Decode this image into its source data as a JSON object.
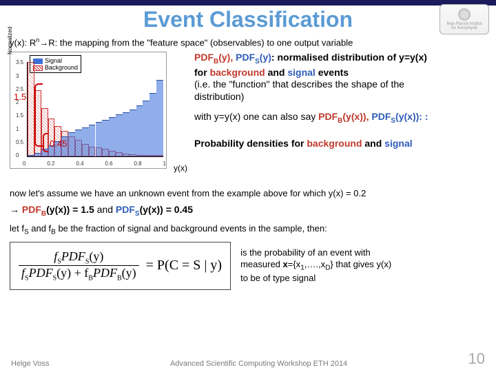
{
  "header": {
    "title": "Event Classification"
  },
  "logo": {
    "line1": "Max-Planck-Institut",
    "line2": "für Kernphysik"
  },
  "line1": {
    "lhs": "y(x): R",
    "sup": "n",
    "arrow": "→",
    "rhs": "R:  the mapping from the \"feature space\" (observables) to one output variable"
  },
  "chart": {
    "ylabel": "Normalized",
    "legend_signal": "Signal",
    "legend_background": "Background",
    "anno_bkg": "1.5",
    "anno_sig": "0.45",
    "yx_label": "y(x)",
    "xticks": [
      "0",
      "0.2",
      "0.4",
      "0.6",
      "0.8",
      "1"
    ],
    "yticks": [
      "0",
      "0.5",
      "1",
      "1.5",
      "2",
      "2.5",
      "3",
      "3.5"
    ]
  },
  "pdf_block": {
    "t1a": "PDF",
    "t1b": "B",
    "t1c": "(y), ",
    "t2a": "PDF",
    "t2b": "S",
    "t2c": "(y)",
    "t3": ":  normalised distribution of y=y(x)",
    "t4a": "   for ",
    "t4b": "background",
    "t4c": " and ",
    "t4d": "signal",
    "t4e": " events",
    "t5": "(i.e. the \"function\" that describes the shape of the",
    "t6": "   distribution)",
    "t7a": "with y=y(x) one can also say ",
    "t7b": "PDF",
    "t7c": "B",
    "t7d": "(y(x)), ",
    "t7e": "PDF",
    "t7f": "S",
    "t7g": "(y(x)): :",
    "t8a": "Probability densities for ",
    "t8b": "background",
    "t8c": " and ",
    "t8d": "signal"
  },
  "body": {
    "p1": "now let's assume we have an unknown event from the example above for which  y(x) = 0.2",
    "p2_arrow": "→ ",
    "p2a": "PDF",
    "p2b": "B",
    "p2c": "(y(x)) = 1.5",
    "p2d": "  and ",
    "p2e": "PDF",
    "p2f": "S",
    "p2g": "(y(x)) = 0.45",
    "p3a": "let f",
    "p3b": "S",
    "p3c": " and f",
    "p3d": "B",
    "p3e": " be the fraction of signal and background events in the sample, then:"
  },
  "equation": {
    "num": "f",
    "num_sub": "S",
    "num2": "PDF",
    "num2_sub": "S",
    "num3": "(y)",
    "den1": "f",
    "den1_sub": "S",
    "den2": "PDF",
    "den2_sub": "S",
    "den3": "(y) + f",
    "den3_sub": "B",
    "den4": "PDF",
    "den4_sub": "B",
    "den5": "(y)",
    "rhs": "= P(C = S | y)"
  },
  "eqright": {
    "l1": "is the probability of an event with",
    "l2a": "measured ",
    "l2b": "x",
    "l2c": "={x",
    "l2d": "1",
    "l2e": ",….,x",
    "l2f": "D",
    "l2g": "} that gives y(x)",
    "l3": "to be of type signal"
  },
  "footer": {
    "author": "Helge Voss",
    "venue": "Advanced Scientific Computing Workshop ETH 2014",
    "page": "10"
  },
  "chart_data": {
    "type": "bar",
    "title": "",
    "xlabel": "y(x)",
    "ylabel": "Normalized",
    "xlim": [
      0,
      1
    ],
    "ylim": [
      0,
      3.7
    ],
    "bin_edges": [
      0.0,
      0.05,
      0.1,
      0.15,
      0.2,
      0.25,
      0.3,
      0.35,
      0.4,
      0.45,
      0.5,
      0.55,
      0.6,
      0.65,
      0.7,
      0.75,
      0.8,
      0.85,
      0.9,
      0.95,
      1.0
    ],
    "series": [
      {
        "name": "Background",
        "values": [
          3.7,
          2.6,
          1.9,
          1.5,
          1.2,
          1.0,
          0.8,
          0.65,
          0.5,
          0.4,
          0.35,
          0.3,
          0.22,
          0.18,
          0.12,
          0.08,
          0.05,
          0.03,
          0.02,
          0.01
        ]
      },
      {
        "name": "Signal",
        "values": [
          0.05,
          0.15,
          0.3,
          0.45,
          0.6,
          0.8,
          0.95,
          1.05,
          1.15,
          1.25,
          1.35,
          1.45,
          1.55,
          1.65,
          1.75,
          1.85,
          2.0,
          2.2,
          2.5,
          3.0
        ]
      }
    ],
    "annotations": [
      {
        "label": "1.5",
        "series": "Background",
        "x": 0.2,
        "y": 1.5
      },
      {
        "label": "0.45",
        "series": "Signal",
        "x": 0.2,
        "y": 0.45
      }
    ]
  }
}
